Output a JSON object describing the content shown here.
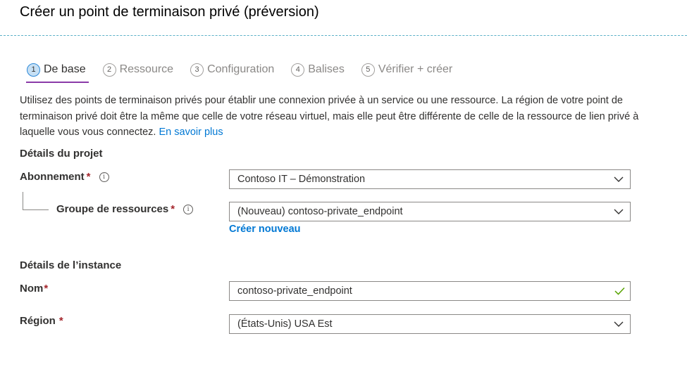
{
  "page": {
    "title": "Créer un point de terminaison privé (préversion)"
  },
  "tabs": [
    {
      "num": "1",
      "label": "De base",
      "active": true
    },
    {
      "num": "2",
      "label": "Ressource"
    },
    {
      "num": "3",
      "label": "Configuration"
    },
    {
      "num": "4",
      "label": "Balises"
    },
    {
      "num": "5",
      "label": "Vérifier + créer"
    }
  ],
  "description": {
    "text": "Utilisez des points de terminaison privés pour établir une connexion privée à un service ou une ressource. La région de votre point de terminaison privé doit être la même que celle de votre réseau virtuel, mais elle peut être différente de celle de la ressource de lien privé à laquelle vous vous connectez. ",
    "link": "En savoir plus"
  },
  "project": {
    "heading": "Détails du projet",
    "subscription_label": "Abonnement",
    "subscription_value": "Contoso IT – Démonstration",
    "resource_group_label": "Groupe de ressources",
    "resource_group_value": "(Nouveau) contoso-private_endpoint",
    "create_new": "Créer nouveau"
  },
  "instance": {
    "heading": "Détails de l’instance",
    "name_label": "Nom",
    "name_value": "contoso-private_endpoint",
    "region_label": "Région",
    "region_value": "(États-Unis) USA Est"
  },
  "required_mark": "*",
  "info_glyph": "i",
  "colors": {
    "accent": "#8a3ba8",
    "link": "#0078d4",
    "required": "#a4262c",
    "valid": "#57a300"
  }
}
